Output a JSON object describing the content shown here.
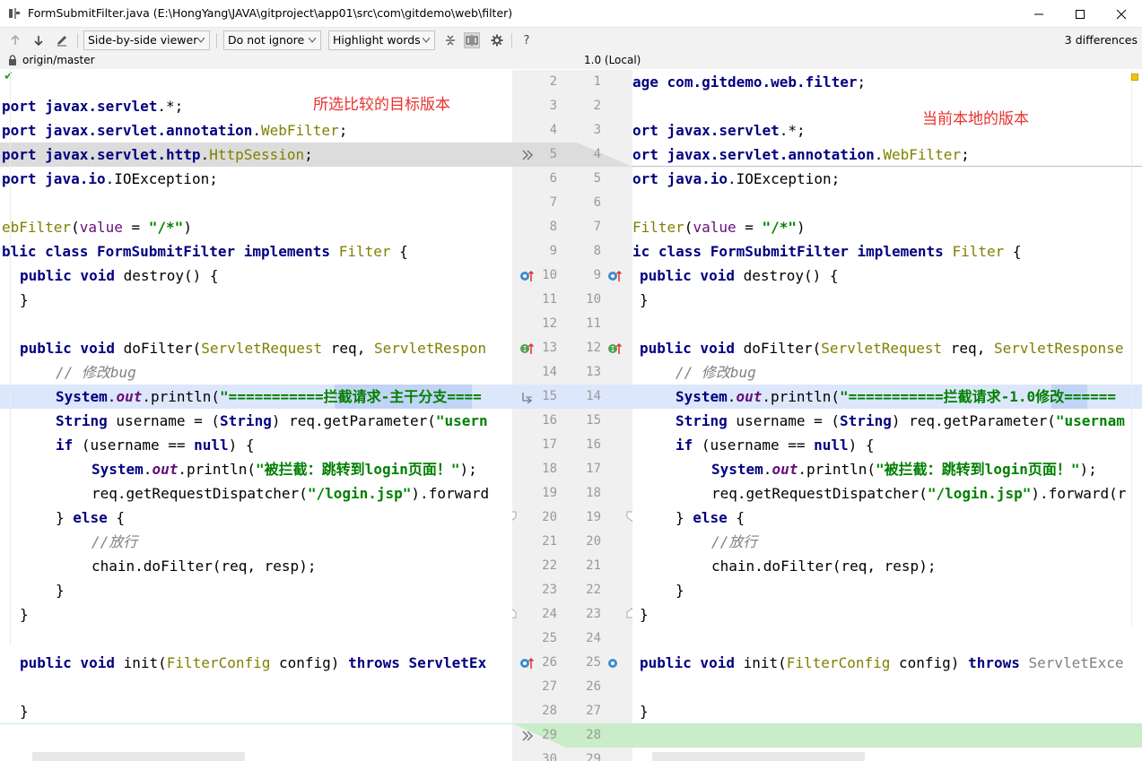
{
  "window": {
    "title": "FormSubmitFilter.java (E:\\HongYang\\JAVA\\gitproject\\app01\\src\\com\\gitdemo\\web\\filter)"
  },
  "toolbar": {
    "viewer": "Side-by-side viewer",
    "ignore": "Do not ignore",
    "highlight": "Highlight words",
    "help": "?",
    "differences": "3 differences"
  },
  "header": {
    "left": "origin/master",
    "right": "1.0 (Local)"
  },
  "annotations": {
    "left": "所选比较的目标版本",
    "right": "当前本地的版本"
  },
  "gutter": {
    "left_numbers": [
      "2",
      "3",
      "4",
      "5",
      "6",
      "7",
      "8",
      "9",
      "10",
      "11",
      "12",
      "13",
      "14",
      "15",
      "16",
      "17",
      "18",
      "19",
      "20",
      "21",
      "22",
      "23",
      "24",
      "25",
      "26",
      "27",
      "28",
      "29",
      "30"
    ],
    "right_numbers": [
      "1",
      "2",
      "3",
      "4",
      "5",
      "6",
      "7",
      "8",
      "9",
      "10",
      "11",
      "12",
      "13",
      "14",
      "15",
      "16",
      "17",
      "18",
      "19",
      "20",
      "21",
      "22",
      "23",
      "24",
      "25",
      "26",
      "27",
      "28",
      "29"
    ]
  },
  "left_code": [
    "",
    "port javax.servlet.*;",
    "port javax.servlet.annotation.WebFilter;",
    "port javax.servlet.http.HttpSession;",
    "port java.io.IOException;",
    "",
    "ebFilter(value = \"/*\")",
    "blic class FormSubmitFilter implements Filter {",
    "  public void destroy() {",
    "  }",
    "",
    "  public void doFilter(ServletRequest req, ServletRespon",
    "      // 修改bug",
    "      System.out.println(\"===========拦截请求-主干分支====",
    "      String username = (String) req.getParameter(\"usern",
    "      if (username == null) {",
    "          System.out.println(\"被拦截：跳转到login页面！\");",
    "          req.getRequestDispatcher(\"/login.jsp\").forward",
    "      } else {",
    "          //放行",
    "          chain.doFilter(req, resp);",
    "      }",
    "  }",
    "",
    "  public void init(FilterConfig config) throws ServletEx",
    "",
    "  }"
  ],
  "right_code": [
    "age com.gitdemo.web.filter;",
    "",
    "ort javax.servlet.*;",
    "ort javax.servlet.annotation.WebFilter;",
    "ort java.io.IOException;",
    "",
    "Filter(value = \"/*\")",
    "ic class FormSubmitFilter implements Filter {",
    "public void destroy() {",
    "}",
    "",
    "public void doFilter(ServletRequest req, ServletResponse",
    "    // 修改bug",
    "    System.out.println(\"===========拦截请求-1.0修改======",
    "    String username = (String) req.getParameter(\"usernam",
    "    if (username == null) {",
    "        System.out.println(\"被拦截：跳转到login页面！\");",
    "        req.getRequestDispatcher(\"/login.jsp\").forward(r",
    "    } else {",
    "        //放行",
    "        chain.doFilter(req, resp);",
    "    }",
    "}",
    "",
    "public void init(FilterConfig config) throws ServletExce",
    "",
    "}"
  ],
  "colors": {
    "changed_line": "#dde7fb",
    "removed_line": "#dcdcdc",
    "added_line": "#c9ecc9",
    "annotation": "#e8322d"
  }
}
